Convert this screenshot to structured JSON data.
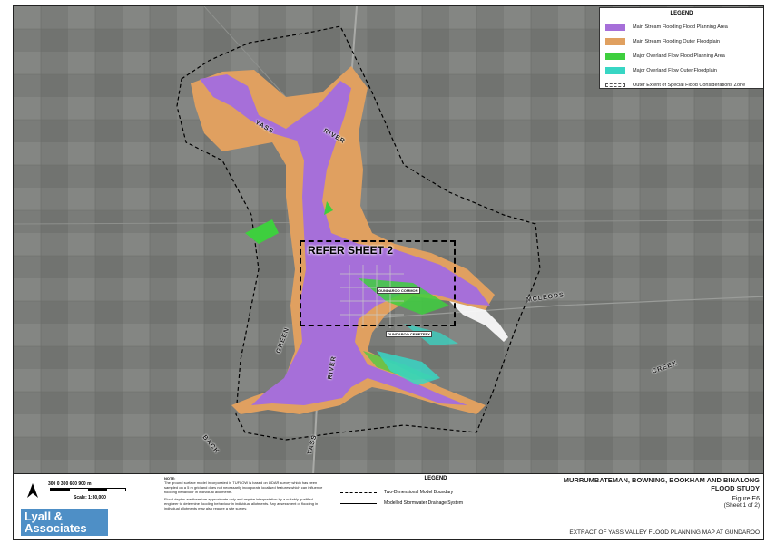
{
  "legend": {
    "title": "LEGEND",
    "items": [
      {
        "label": "Main Stream Flooding Flood Planning Area",
        "color": "#a66fd9"
      },
      {
        "label": "Main Stream Flooding Outer Floodplain",
        "color": "#e0a060"
      },
      {
        "label": "Major Overland Flow Flood Planning Area",
        "color": "#3ecf3e"
      },
      {
        "label": "Major Overland Flow Outer Floodplain",
        "color": "#38d6c4"
      },
      {
        "label": "Outer Extent of Special Flood Considerations Zone",
        "color": "#ffffff"
      }
    ]
  },
  "map": {
    "refer_label": "REFER SHEET 2",
    "river_labels": [
      "YASS",
      "RIVER",
      "GREEN",
      "RIVER",
      "YASS",
      "BACK",
      "CREEK",
      "MCLEODS"
    ],
    "place_labels": [
      "GUNDAROO COMMON",
      "GUNDAROO CEMETERY"
    ]
  },
  "scale": {
    "numbers": "300    0    300    600    900 m",
    "text": "Scale: 1:30,000"
  },
  "logo": {
    "line1": "Lyall &",
    "line2": "Associates"
  },
  "note": {
    "heading": "NOTE:",
    "text1": "The ground surface model incorporated in TUFLOW is based on LiDAR survey which has been sampled on a 5 m grid and does not necessarily incorporate localised features which can influence flooding behaviour in individual allotments.",
    "text2": "Flood depths are therefore approximate only and require interpretation by a suitably qualified engineer to determine flooding behaviour in individual allotments. Any assessment of flooding in individual allotments may also require a site survey."
  },
  "footer_legend": {
    "title": "LEGEND",
    "items": [
      "Two-Dimensional Model Boundary",
      "Modelled Stormwater Drainage System"
    ]
  },
  "title_block": {
    "line1": "MURRUMBATEMAN, BOWNING, BOOKHAM AND BINALONG",
    "line2": "FLOOD STUDY",
    "figure": "Figure E6",
    "sheet": "(Sheet 1 of 2)",
    "extract": "EXTRACT OF YASS VALLEY FLOOD PLANNING MAP AT GUNDAROO"
  }
}
